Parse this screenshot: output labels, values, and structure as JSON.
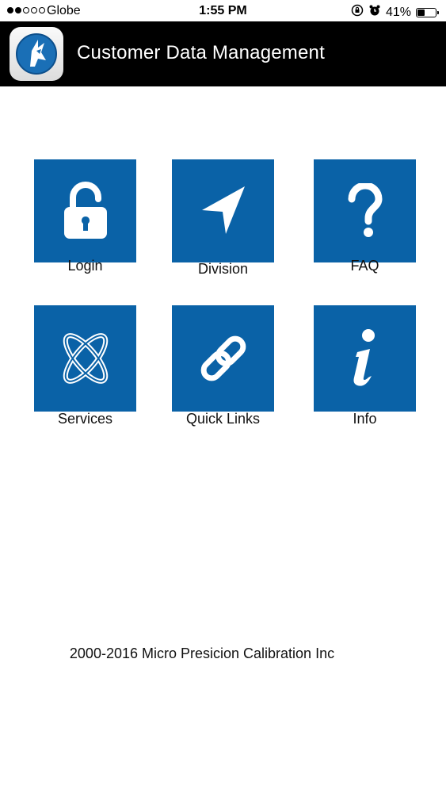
{
  "status_bar": {
    "carrier": "Globe",
    "time": "1:55 PM",
    "battery_percent": "41%",
    "battery_level": 0.41,
    "signal_bars_filled": 2,
    "signal_bars_total": 5
  },
  "header": {
    "title": "Customer Data Management"
  },
  "tiles": [
    {
      "label": "Login",
      "icon": "padlock-icon"
    },
    {
      "label": "Division",
      "icon": "navigation-arrow-icon"
    },
    {
      "label": "FAQ",
      "icon": "question-mark-icon"
    },
    {
      "label": "Services",
      "icon": "atom-icon"
    },
    {
      "label": "Quick Links",
      "icon": "chain-link-icon"
    },
    {
      "label": "Info",
      "icon": "info-icon"
    }
  ],
  "footer": {
    "copyright": "2000-2016 Micro Presicion Calibration Inc"
  },
  "colors": {
    "tile_blue": "#0a62a7",
    "header_bg": "#000000",
    "header_text": "#ffffff",
    "logo_blue": "#1a6fb6"
  }
}
